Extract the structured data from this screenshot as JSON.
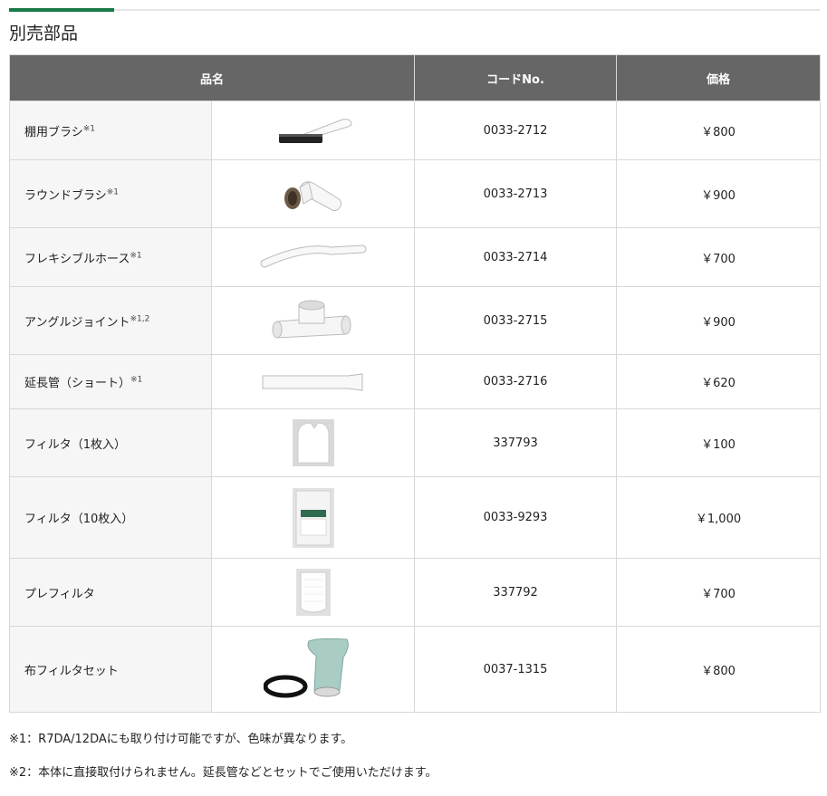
{
  "section_title": "別売部品",
  "table": {
    "headers": {
      "name": "品名",
      "code": "コードNo.",
      "price": "価格"
    },
    "rows": [
      {
        "name": "棚用ブラシ",
        "note": "※1",
        "code": "0033-2712",
        "price": "￥800",
        "icon": "shelf-brush"
      },
      {
        "name": "ラウンドブラシ",
        "note": "※1",
        "code": "0033-2713",
        "price": "￥900",
        "icon": "round-brush"
      },
      {
        "name": "フレキシブルホース",
        "note": "※1",
        "code": "0033-2714",
        "price": "￥700",
        "icon": "flexible-hose"
      },
      {
        "name": "アングルジョイント",
        "note": "※1,2",
        "code": "0033-2715",
        "price": "￥900",
        "icon": "angle-joint"
      },
      {
        "name": "延長管（ショート）",
        "note": "※1",
        "code": "0033-2716",
        "price": "￥620",
        "icon": "extension-pipe"
      },
      {
        "name": "フィルタ（1枚入）",
        "note": "",
        "code": "337793",
        "price": "￥100",
        "icon": "filter"
      },
      {
        "name": "フィルタ（10枚入）",
        "note": "",
        "code": "0033-9293",
        "price": "￥1,000",
        "icon": "filter-pack"
      },
      {
        "name": "プレフィルタ",
        "note": "",
        "code": "337792",
        "price": "￥700",
        "icon": "pre-filter"
      },
      {
        "name": "布フィルタセット",
        "note": "",
        "code": "0037-1315",
        "price": "￥800",
        "icon": "cloth-filter-set"
      }
    ]
  },
  "notes": [
    "※1：R7DA/12DAにも取り付け可能ですが、色味が異なります。",
    "※2：本体に直接取付けられません。延長管などとセットでご使用いただけます。"
  ]
}
